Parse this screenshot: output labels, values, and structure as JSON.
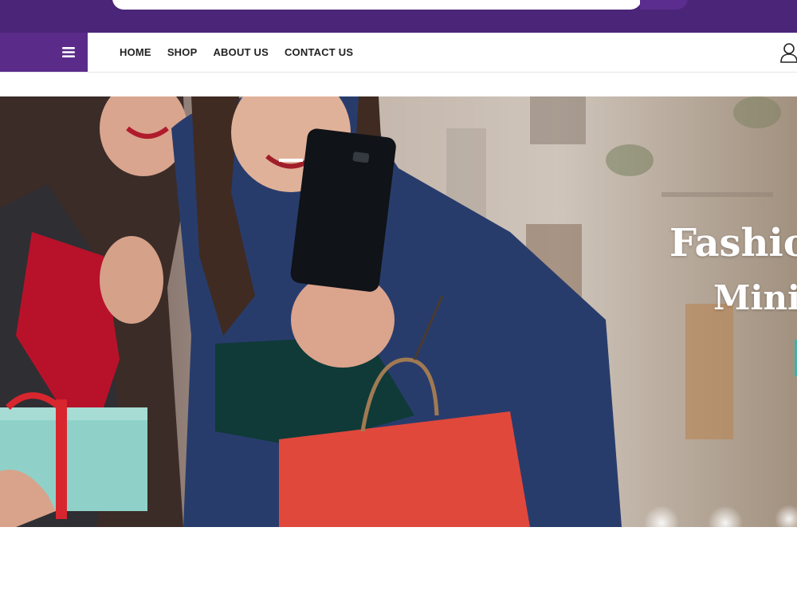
{
  "search": {
    "placeholder": "",
    "value": ""
  },
  "icons": {
    "search": "search-icon",
    "menu": "hamburger-menu-icon",
    "user": "user-icon"
  },
  "nav": {
    "items": [
      {
        "label": "HOME"
      },
      {
        "label": "SHOP"
      },
      {
        "label": "ABOUT US"
      },
      {
        "label": "CONTACT US"
      }
    ]
  },
  "hero": {
    "title": "Fashion",
    "subtitle": "Minin"
  },
  "colors": {
    "top_bar": "#4a2578",
    "menu_toggle": "#5b2b8a",
    "nav_text": "#222222",
    "hero_text": "#ffffff",
    "accent": "#3bb3a8"
  }
}
